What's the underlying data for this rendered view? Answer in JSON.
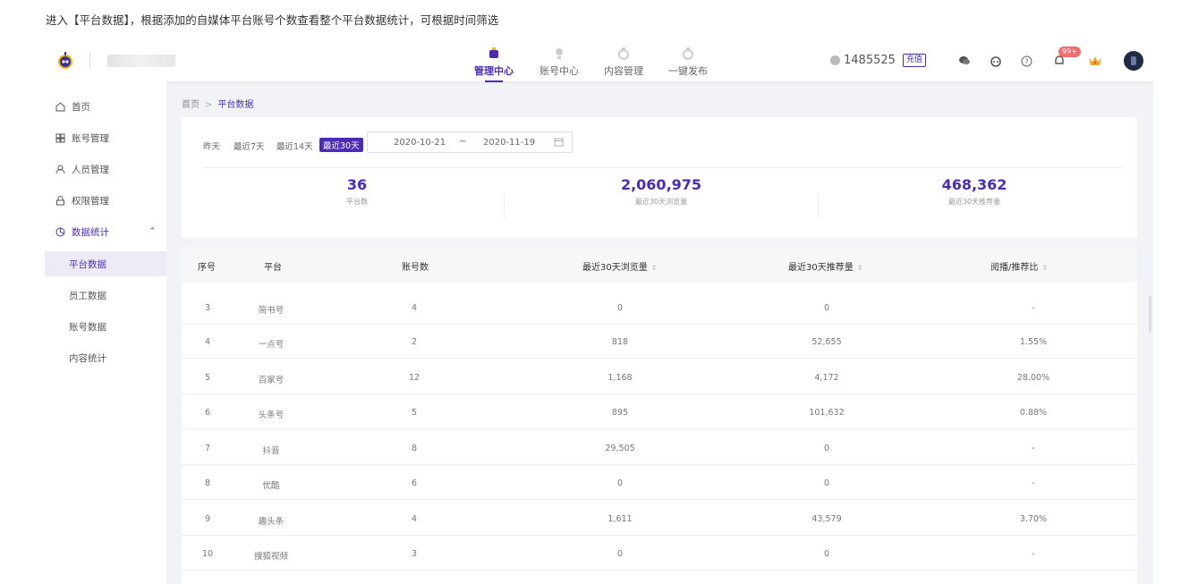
{
  "instruction": "进入【平台数据】，根据添加的自媒体平台账号个数查看整个平台数据统计，可根据时间筛选",
  "header": {
    "tabs": [
      {
        "label": "管理中心",
        "active": true
      },
      {
        "label": "账号中心",
        "active": false
      },
      {
        "label": "内容管理",
        "active": false
      },
      {
        "label": "一键发布",
        "active": false
      }
    ],
    "points": "1485525",
    "recharge_label": "充值",
    "notification_badge": "99+"
  },
  "sidebar": {
    "items": [
      {
        "label": "首页",
        "icon": "home-icon"
      },
      {
        "label": "账号管理",
        "icon": "grid-icon"
      },
      {
        "label": "人员管理",
        "icon": "user-icon"
      },
      {
        "label": "权限管理",
        "icon": "lock-icon"
      },
      {
        "label": "数据统计",
        "icon": "chart-icon"
      }
    ],
    "sub_items": [
      {
        "label": "平台数据",
        "active": true
      },
      {
        "label": "员工数据",
        "active": false
      },
      {
        "label": "账号数据",
        "active": false
      },
      {
        "label": "内容统计",
        "active": false
      }
    ]
  },
  "breadcrumb": {
    "home": "首页",
    "sep": ">",
    "current": "平台数据"
  },
  "filter": {
    "quick": [
      "昨天",
      "最近7天",
      "最近14天",
      "最近30天"
    ],
    "active_quick": "最近30天",
    "start_date": "2020-10-21",
    "range_sep": "~",
    "end_date": "2020-11-19"
  },
  "stats": [
    {
      "value": "36",
      "label": "平台数"
    },
    {
      "value": "2,060,975",
      "label": "最近30天浏览量"
    },
    {
      "value": "468,362",
      "label": "最近30天推荐量"
    }
  ],
  "table": {
    "headers": [
      "序号",
      "平台",
      "账号数",
      "最近30天浏览量",
      "最近30天推荐量",
      "阅播/推荐比"
    ],
    "rows": [
      [
        "3",
        "简书号",
        "4",
        "0",
        "0",
        "-"
      ],
      [
        "4",
        "一点号",
        "2",
        "818",
        "52,655",
        "1.55%"
      ],
      [
        "5",
        "百家号",
        "12",
        "1,168",
        "4,172",
        "28.00%"
      ],
      [
        "6",
        "头条号",
        "5",
        "895",
        "101,632",
        "0.88%"
      ],
      [
        "7",
        "抖音",
        "8",
        "29,505",
        "0",
        "-"
      ],
      [
        "8",
        "优酷",
        "6",
        "0",
        "0",
        "-"
      ],
      [
        "9",
        "趣头条",
        "4",
        "1,611",
        "43,579",
        "3.70%"
      ],
      [
        "10",
        "搜狐视频",
        "3",
        "0",
        "0",
        "-"
      ]
    ]
  },
  "colors": {
    "accent": "#4b2bb8",
    "badge": "#f56c6c"
  }
}
